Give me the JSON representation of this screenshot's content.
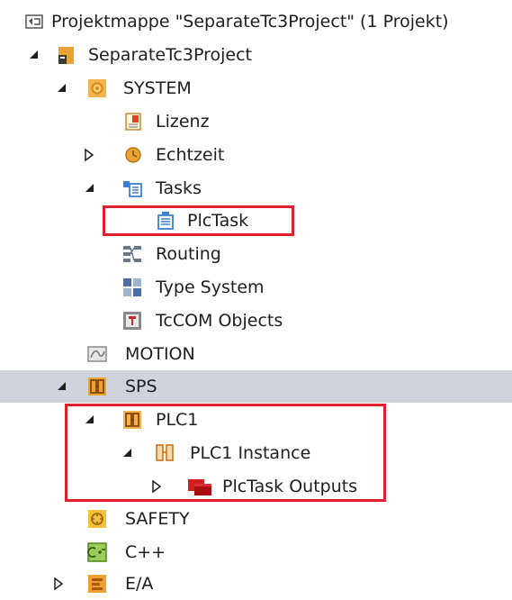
{
  "tree": {
    "solution": {
      "label": "Projektmappe \"SeparateTc3Project\" (1 Projekt)",
      "icon": "solution-icon"
    },
    "project": {
      "label": "SeparateTc3Project",
      "icon": "project-icon",
      "expanded": true
    },
    "system": {
      "label": "SYSTEM",
      "icon": "system-gear-icon",
      "expanded": true
    },
    "lizenz": {
      "label": "Lizenz",
      "icon": "license-icon"
    },
    "echtzeit": {
      "label": "Echtzeit",
      "icon": "realtime-icon",
      "expanded": false
    },
    "tasks": {
      "label": "Tasks",
      "icon": "tasks-icon",
      "expanded": true
    },
    "plctask": {
      "label": "PlcTask",
      "icon": "task-icon"
    },
    "routing": {
      "label": "Routing",
      "icon": "routing-icon"
    },
    "typesystem": {
      "label": "Type System",
      "icon": "type-system-icon"
    },
    "tccom": {
      "label": "TcCOM Objects",
      "icon": "tccom-icon"
    },
    "motion": {
      "label": "MOTION",
      "icon": "motion-icon"
    },
    "sps": {
      "label": "SPS",
      "icon": "plc-icon",
      "expanded": true,
      "selected": true
    },
    "plc1": {
      "label": "PLC1",
      "icon": "plc-project-icon",
      "expanded": true
    },
    "plc1instance": {
      "label": "PLC1 Instance",
      "icon": "plc-instance-icon",
      "expanded": true
    },
    "outputs": {
      "label": "PlcTask Outputs",
      "icon": "outputs-icon",
      "expanded": false
    },
    "safety": {
      "label": "SAFETY",
      "icon": "safety-icon"
    },
    "cpp": {
      "label": "C++",
      "icon": "cpp-icon"
    },
    "ea": {
      "label": "E/A",
      "icon": "io-icon",
      "expanded": false
    }
  },
  "colors": {
    "highlight": "#e0202a",
    "selection": "#cfd3dc",
    "gold": "#e8a330"
  }
}
